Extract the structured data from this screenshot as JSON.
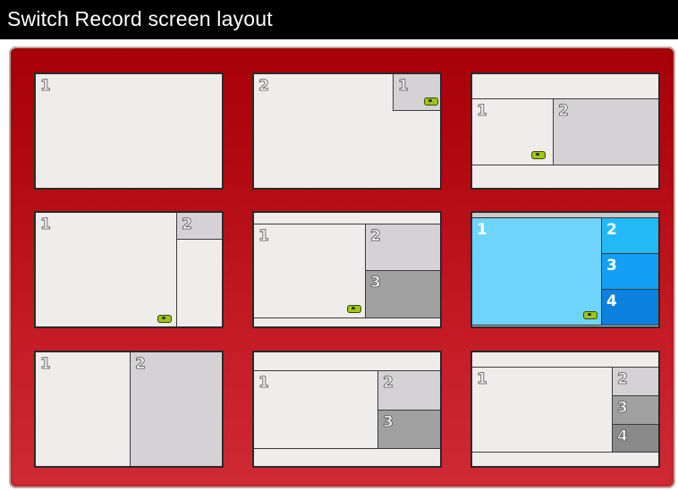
{
  "title": "Switch Record screen layout",
  "colors": {
    "panel": "#b40a12",
    "cell_light": "#efecec",
    "cell_gray": "#d4d2d4",
    "cell_mid": "#a0a0a0",
    "selected_blue": "#6fd4fb"
  },
  "icons": {
    "camera": "camera-icon"
  },
  "layouts": [
    {
      "name": "single",
      "labels": [
        "1"
      ]
    },
    {
      "name": "pip",
      "labels": [
        "2",
        "1"
      ]
    },
    {
      "name": "side-by-side-letterbox",
      "labels": [
        "1",
        "2"
      ]
    },
    {
      "name": "main-with-corner",
      "labels": [
        "1",
        "2"
      ]
    },
    {
      "name": "main-plus-two-stacked",
      "labels": [
        "1",
        "2",
        "3"
      ]
    },
    {
      "name": "main-plus-three-stacked",
      "labels": [
        "1",
        "2",
        "3",
        "4"
      ],
      "selected": true
    },
    {
      "name": "split-half",
      "labels": [
        "1",
        "2"
      ]
    },
    {
      "name": "main-plus-two-letterbox",
      "labels": [
        "1",
        "2",
        "3"
      ]
    },
    {
      "name": "main-plus-three-letterbox",
      "labels": [
        "1",
        "2",
        "3",
        "4"
      ]
    }
  ]
}
